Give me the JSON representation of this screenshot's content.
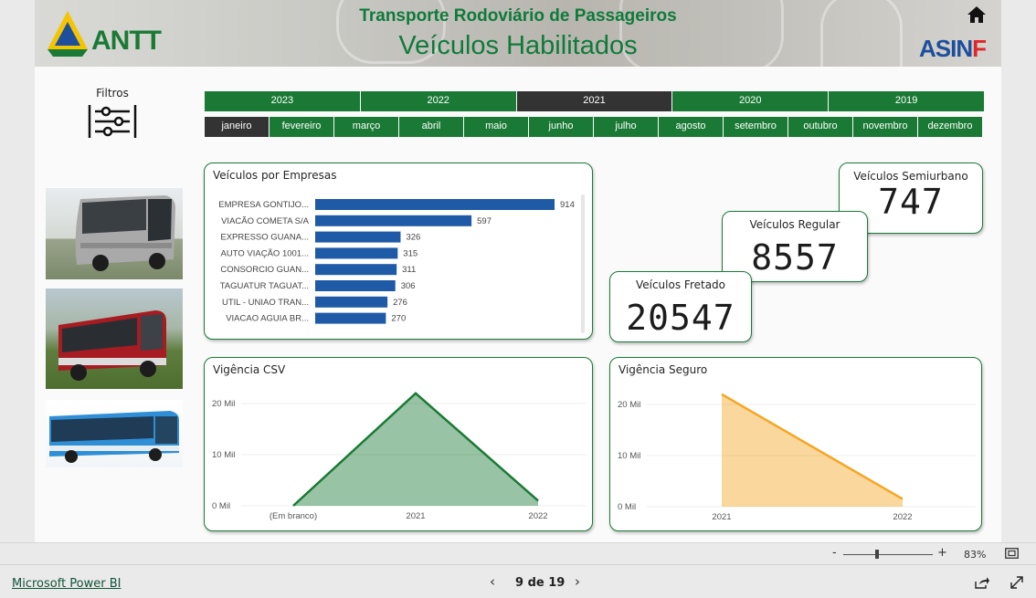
{
  "header": {
    "title": "Transporte Rodoviário de Passageiros",
    "subtitle": "Veículos Habilitados",
    "logo_left": "ANTT",
    "logo_right": "ASINF",
    "home_icon": "home-icon"
  },
  "filters": {
    "label": "Filtros",
    "icon": "sliders-icon",
    "years": [
      {
        "label": "2023",
        "selected": false
      },
      {
        "label": "2022",
        "selected": false
      },
      {
        "label": "2021",
        "selected": true
      },
      {
        "label": "2020",
        "selected": false
      },
      {
        "label": "2019",
        "selected": false
      }
    ],
    "months": [
      {
        "label": "janeiro",
        "selected": true
      },
      {
        "label": "fevereiro",
        "selected": false
      },
      {
        "label": "março",
        "selected": false
      },
      {
        "label": "abril",
        "selected": false
      },
      {
        "label": "maio",
        "selected": false
      },
      {
        "label": "junho",
        "selected": false
      },
      {
        "label": "julho",
        "selected": false
      },
      {
        "label": "agosto",
        "selected": false
      },
      {
        "label": "setembro",
        "selected": false
      },
      {
        "label": "outubro",
        "selected": false
      },
      {
        "label": "novembro",
        "selected": false
      },
      {
        "label": "dezembro",
        "selected": false
      }
    ],
    "colors": {
      "active": "#1a7a35",
      "selected": "#333333"
    }
  },
  "kpis": {
    "semiurbano": {
      "label": "Veículos Semiurbano",
      "value": "747"
    },
    "regular": {
      "label": "Veículos Regular",
      "value": "8557"
    },
    "fretado": {
      "label": "Veículos Fretado",
      "value": "20547"
    }
  },
  "charts": {
    "empresas_title": "Veículos por Empresas",
    "csv_title": "Vigência CSV",
    "seguro_title": "Vigência Seguro"
  },
  "chart_data": [
    {
      "type": "bar",
      "title": "Veículos por Empresas",
      "orientation": "horizontal",
      "categories": [
        "EMPRESA GONTIJO...",
        "VIACÃO COMETA S/A",
        "EXPRESSO GUANA...",
        "AUTO VIAÇÃO 1001...",
        "CONSORCIO GUAN...",
        "TAGUATUR TAGUAT...",
        "UTIL - UNIAO TRAN...",
        "VIACAO AGUIA BR..."
      ],
      "values": [
        914,
        597,
        326,
        315,
        311,
        306,
        276,
        270
      ],
      "color": "#1f5aa6",
      "xlim": [
        0,
        914
      ]
    },
    {
      "type": "area",
      "title": "Vigência CSV",
      "x": [
        "(Em branco)",
        "2021",
        "2022"
      ],
      "y": [
        0,
        22000,
        1000
      ],
      "yticks": [
        "0 Mil",
        "10 Mil",
        "20 Mil"
      ],
      "ylim": [
        0,
        25000
      ],
      "color": "#1a7a35"
    },
    {
      "type": "area",
      "title": "Vigência Seguro",
      "x": [
        "2021",
        "2022"
      ],
      "y": [
        22000,
        1500
      ],
      "yticks": [
        "0 Mil",
        "10 Mil",
        "20 Mil"
      ],
      "ylim": [
        0,
        25000
      ],
      "color": "#f5a623"
    }
  ],
  "statusbar": {
    "zoom_minus": "-",
    "zoom_plus": "+",
    "zoom_level": "83%",
    "zoom_fraction": 0.38,
    "fit_icon": "fit-to-page-icon"
  },
  "footer": {
    "brand_link": "Microsoft Power BI",
    "prev_icon": "‹",
    "page_indicator": "9 de 19",
    "next_icon": "›",
    "share_icon": "share-icon",
    "expand_icon": "fullscreen-icon"
  }
}
